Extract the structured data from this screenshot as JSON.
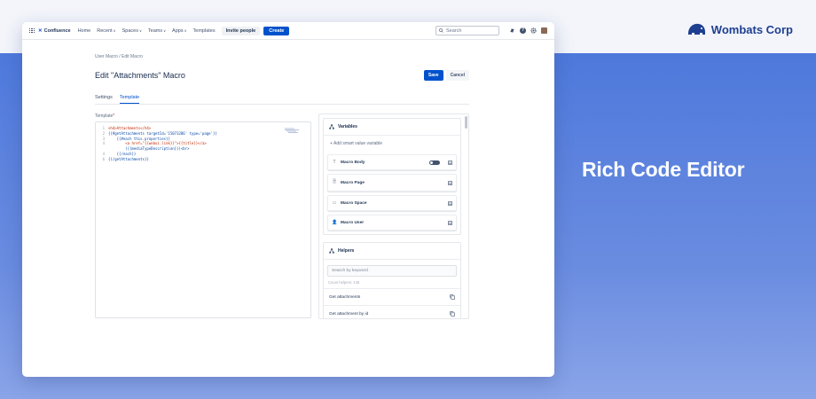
{
  "brand": {
    "name": "Wombats Corp",
    "logo_icon": "wombat-logo-icon",
    "color": "#1e3f91"
  },
  "tagline": "Rich Code Editor",
  "topnav": {
    "product": "Confluence",
    "items": [
      {
        "label": "Home",
        "dropdown": false
      },
      {
        "label": "Recent",
        "dropdown": true
      },
      {
        "label": "Spaces",
        "dropdown": true
      },
      {
        "label": "Teams",
        "dropdown": true
      },
      {
        "label": "Apps",
        "dropdown": true
      },
      {
        "label": "Templates",
        "dropdown": false
      }
    ],
    "invite_label": "Invite people",
    "create_label": "Create",
    "search_placeholder": "Search",
    "accent": "#0052cc"
  },
  "breadcrumb": "User Macro  / Edit Macro",
  "page_title": "Edit \"Attachments\" Macro",
  "save_label": "Save",
  "cancel_label": "Cancel",
  "tabs": [
    {
      "label": "Settings",
      "active": false
    },
    {
      "label": "Template",
      "active": true
    }
  ],
  "template_label": "Template",
  "code_lines": [
    {
      "n": "1",
      "indent": "",
      "text": "<h4>Attachments</h4>"
    },
    {
      "n": "2",
      "indent": "",
      "text": "{{#getAttachments targetId='15073286' type='page'}}"
    },
    {
      "n": "3",
      "indent": "    ",
      "text": "{{#each this.properties}}"
    },
    {
      "n": "4",
      "indent": "        ",
      "text": "<a href=\"{{webui.link}}\">{{title}}</a>"
    },
    {
      "n": "",
      "indent": "        ",
      "text": "({{mediaTypeDescription}})<br>"
    },
    {
      "n": "4",
      "indent": "    ",
      "text": "{{/each}}"
    },
    {
      "n": "6",
      "indent": "",
      "text": "{{/getAttachments}}"
    }
  ],
  "variables": {
    "title": "Variables",
    "add_label": "+ Add smart value variable",
    "items": [
      {
        "icon": "T",
        "label": "Macro Body",
        "toggle": true
      },
      {
        "icon": "🗎",
        "label": "Macro Page",
        "toggle": false
      },
      {
        "icon": "▭",
        "label": "Macro Space",
        "toggle": false
      },
      {
        "icon": "👤",
        "label": "Macro User",
        "toggle": false
      }
    ]
  },
  "helpers": {
    "title": "Helpers",
    "search_placeholder": "Search by keyword",
    "count": "Count helpers: 145",
    "items": [
      {
        "label": "Get attachments"
      },
      {
        "label": "Get attachment by id"
      }
    ]
  }
}
